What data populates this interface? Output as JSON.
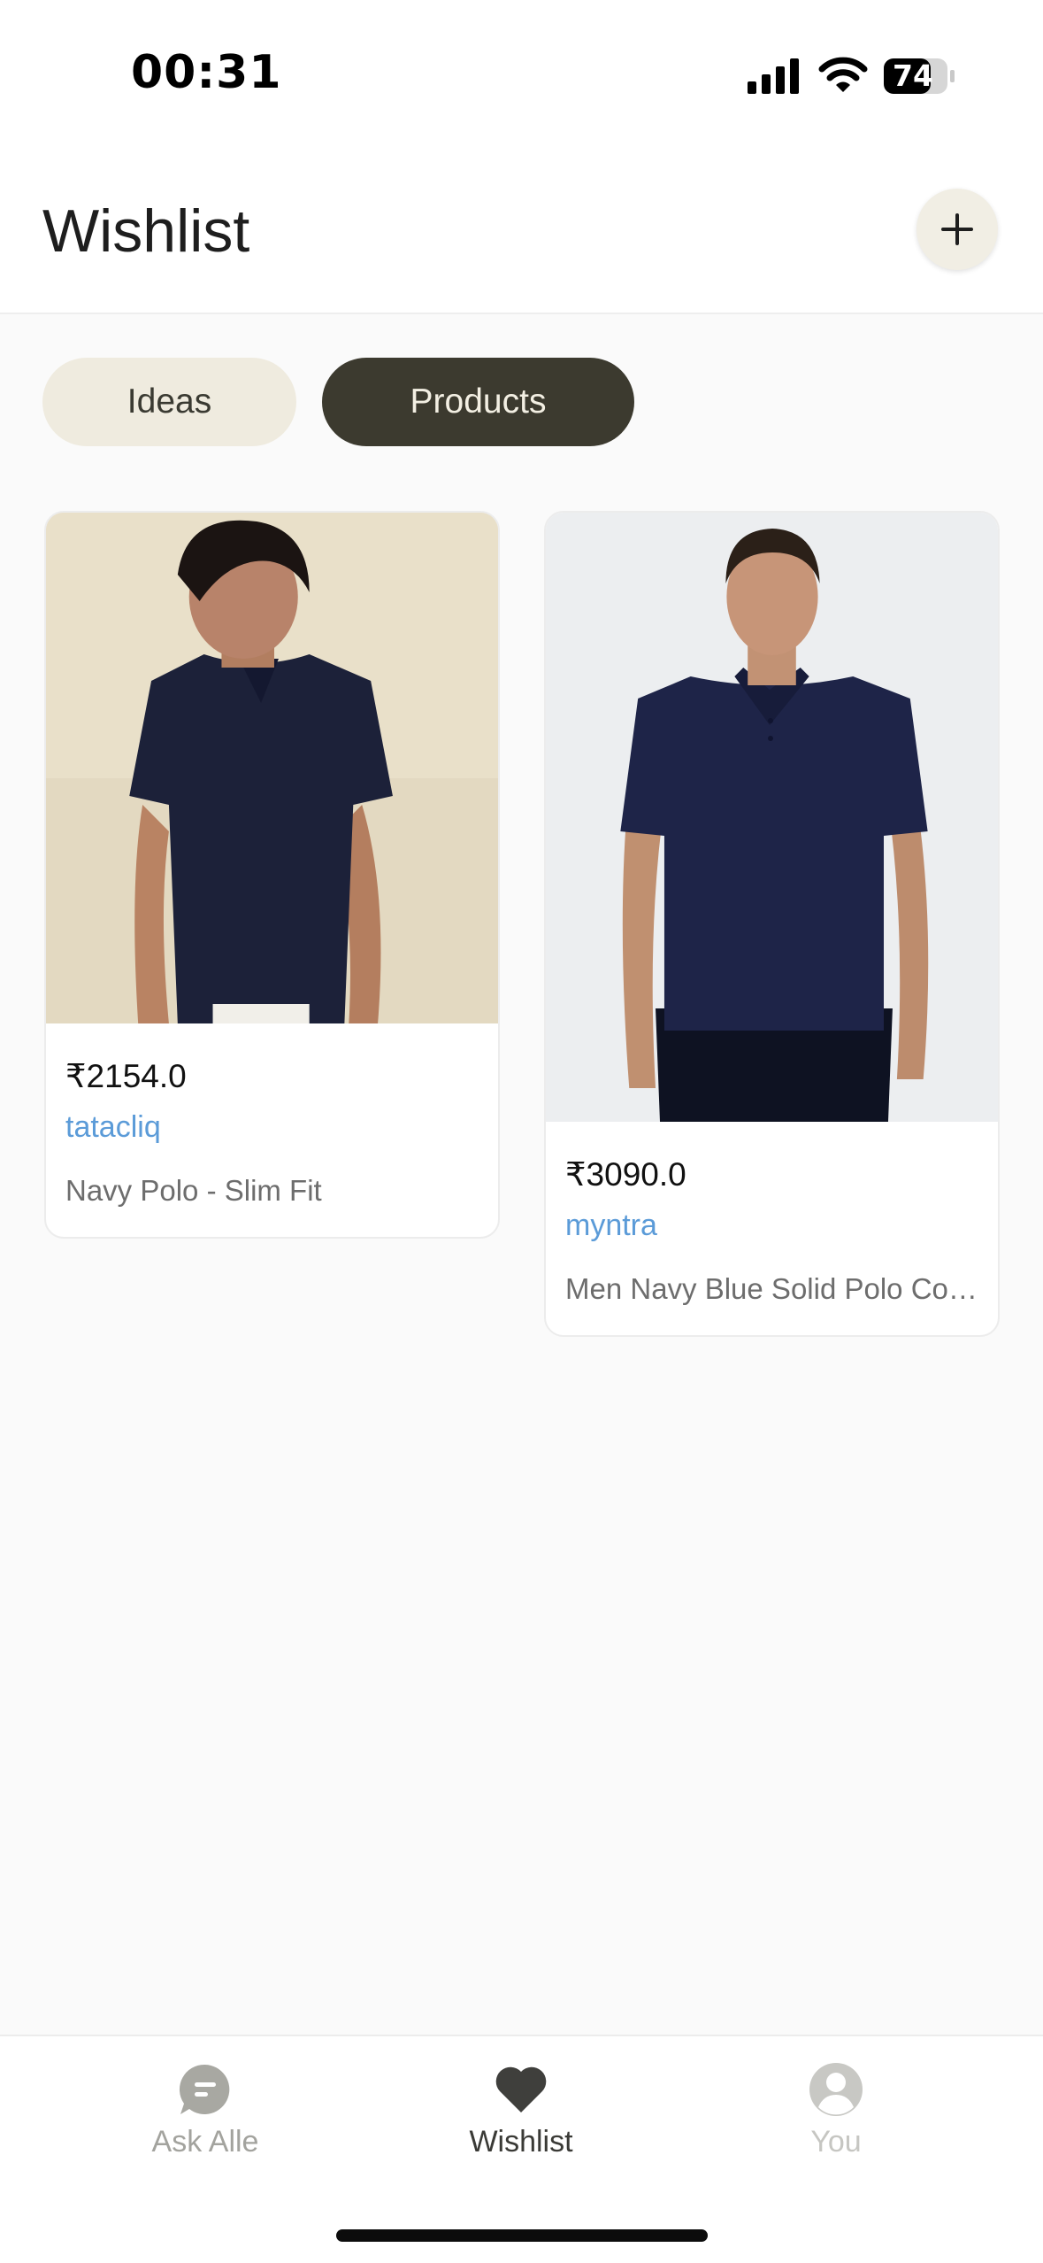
{
  "status_bar": {
    "time": "00:31",
    "battery": "74",
    "icons": [
      "signal-icon",
      "wifi-icon",
      "battery-icon"
    ]
  },
  "header": {
    "title": "Wishlist",
    "add_icon": "plus-icon"
  },
  "tabs": [
    {
      "label": "Ideas",
      "active": false
    },
    {
      "label": "Products",
      "active": true
    }
  ],
  "products": [
    {
      "price": "₹2154.0",
      "store": "tatacliq",
      "name": "Navy Polo - Slim Fit",
      "image": "product-photo-navy-polo"
    },
    {
      "price": "₹3090.0",
      "store": "myntra",
      "name": "Men Navy Blue Solid Polo Collar T-Shirt",
      "image": "product-photo-navy-polo"
    }
  ],
  "bottom_nav": [
    {
      "label": "Ask Alle",
      "icon": "chat-bubble-icon",
      "active": false
    },
    {
      "label": "Wishlist",
      "icon": "heart-icon",
      "active": true
    },
    {
      "label": "You",
      "icon": "user-avatar-icon",
      "active": false
    }
  ],
  "colors": {
    "accent_dark": "#3c3a2f",
    "tab_light": "#efebdf",
    "store_link": "#5b9bd8"
  }
}
